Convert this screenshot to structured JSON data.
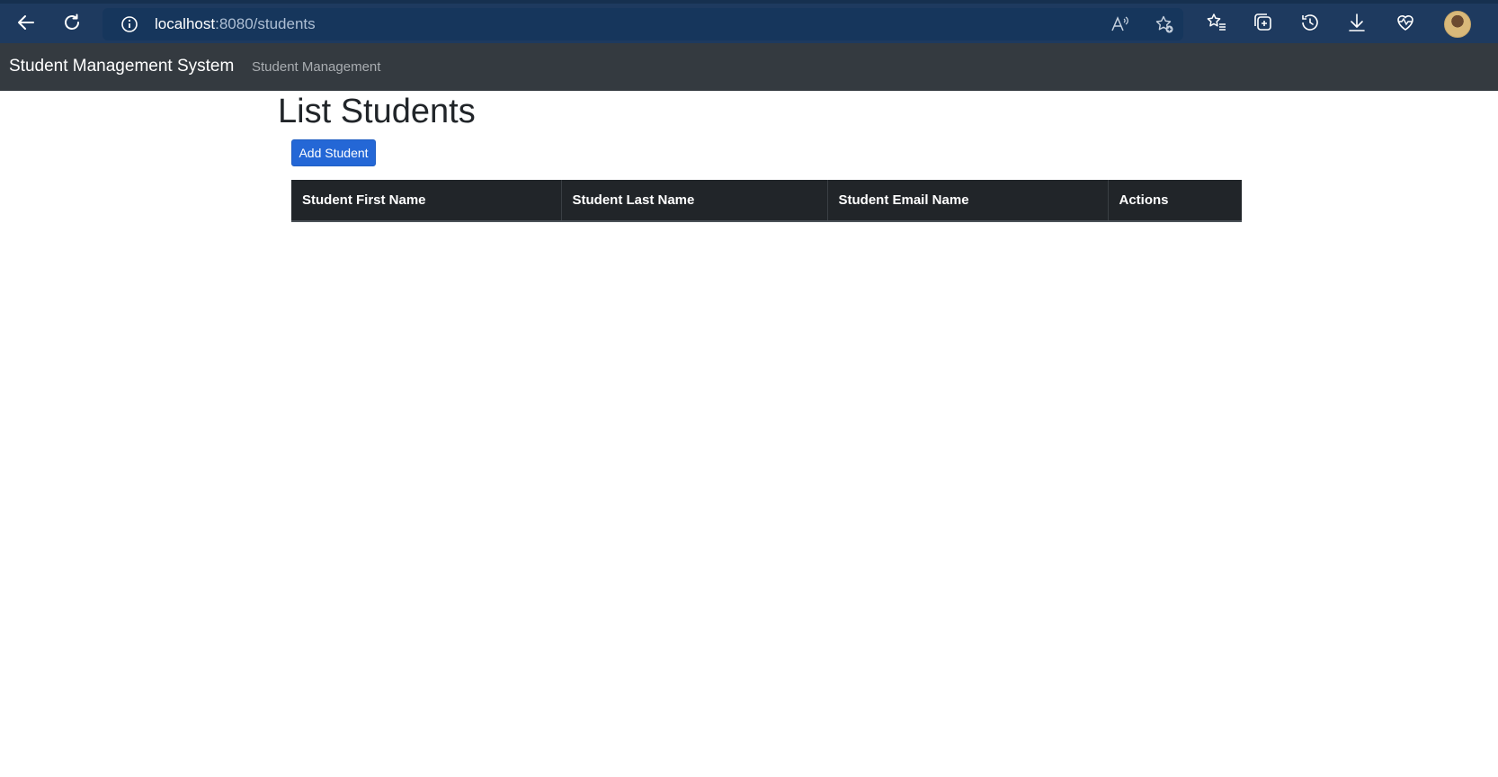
{
  "browser": {
    "url_host": "localhost",
    "url_path": ":8080/students",
    "icons": [
      "back-arrow-icon",
      "reload-icon",
      "info-icon",
      "read-aloud-icon",
      "add-favorite-icon",
      "favorites-icon",
      "collections-icon",
      "history-icon",
      "downloads-icon",
      "browser-essentials-icon",
      "profile-avatar"
    ]
  },
  "navbar": {
    "brand": "Student Management System",
    "link": "Student Management"
  },
  "main": {
    "title": "List Students",
    "add_button": "Add Student"
  },
  "table": {
    "headers": [
      "Student First Name",
      "Student Last Name",
      "Student Email Name",
      "Actions"
    ],
    "rows": []
  },
  "colors": {
    "browser_bar": "#1e3a5f",
    "navbar": "#343a40",
    "table_header": "#212529",
    "primary_button": "#2467d6"
  }
}
